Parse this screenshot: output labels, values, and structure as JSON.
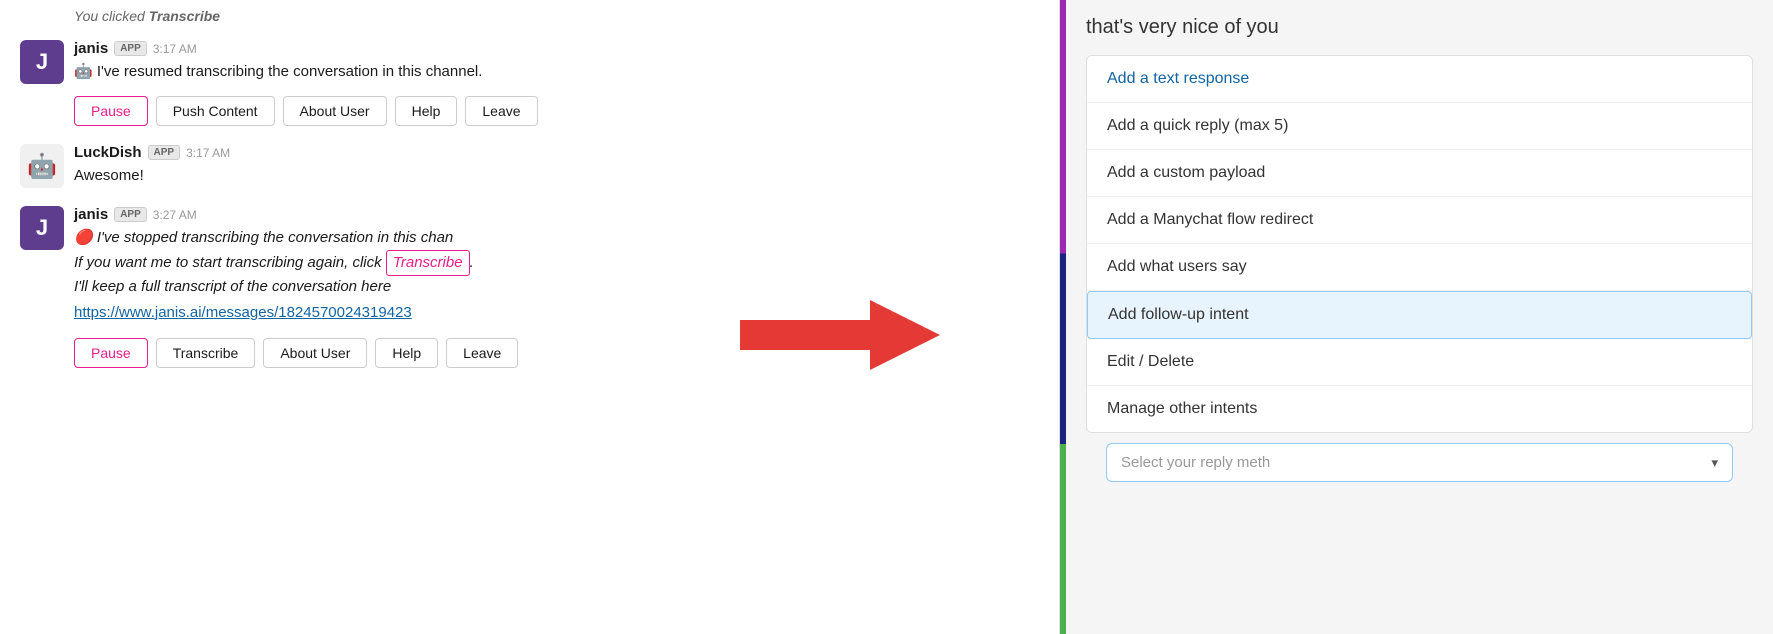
{
  "chat": {
    "you_clicked_label": "You clicked",
    "you_clicked_bold": "Transcribe",
    "messages": [
      {
        "id": "janis-1",
        "user": "janis",
        "badge": "APP",
        "time": "3:17 AM",
        "avatar_type": "janis",
        "avatar_emoji": "J",
        "text_emoji": "🤖",
        "text": "I've resumed transcribing the conversation in this channel.",
        "italic": false,
        "buttons": [
          "Pause",
          "Push Content",
          "About User",
          "Help",
          "Leave"
        ]
      },
      {
        "id": "luckdish-1",
        "user": "LuckDish",
        "badge": "APP",
        "time": "3:17 AM",
        "avatar_type": "luckdish",
        "avatar_emoji": "🤖",
        "text_emoji": "",
        "text": "Awesome!",
        "italic": false,
        "buttons": []
      },
      {
        "id": "janis-2",
        "user": "janis",
        "badge": "APP",
        "time": "3:27 AM",
        "avatar_type": "janis",
        "avatar_emoji": "J",
        "text_emoji": "🔴",
        "text_parts": [
          {
            "text": "I've stopped transcribing the conversation in this chan",
            "italic": true
          },
          {
            "text": "If you want me to start transcribing again, click ",
            "italic": true
          },
          {
            "transcribe_link": "Transcribe"
          },
          {
            "text": ".",
            "italic": true
          },
          {
            "newline": true
          },
          {
            "text": "I'll keep a full transcript of the conversation here",
            "italic": true
          }
        ],
        "link": "https://www.janis.ai/messages/1824570024319423",
        "buttons": [
          "Pause",
          "Transcribe",
          "About User",
          "Help",
          "Leave"
        ]
      }
    ],
    "pause_color": "#e91e8c",
    "transcribe_link_color": "#e91e8c",
    "chat_link_color": "#1264a3"
  },
  "right_panel": {
    "context_text": "that's very nice of you",
    "menu_items": [
      {
        "id": "add-text",
        "label": "Add a text response",
        "type": "link"
      },
      {
        "id": "add-quick",
        "label": "Add a quick reply (max 5)",
        "type": "normal"
      },
      {
        "id": "add-custom",
        "label": "Add a custom payload",
        "type": "normal"
      },
      {
        "id": "add-manychat",
        "label": "Add a Manychat flow redirect",
        "type": "normal"
      },
      {
        "id": "add-what-users",
        "label": "Add what users say",
        "type": "normal"
      },
      {
        "id": "add-followup",
        "label": "Add follow-up intent",
        "type": "highlighted"
      },
      {
        "id": "edit-delete",
        "label": "Edit / Delete",
        "type": "normal"
      },
      {
        "id": "manage-intents",
        "label": "Manage other intents",
        "type": "normal"
      }
    ],
    "select_reply_placeholder": "Select your reply meth",
    "select_reply_chevron": "▾"
  }
}
